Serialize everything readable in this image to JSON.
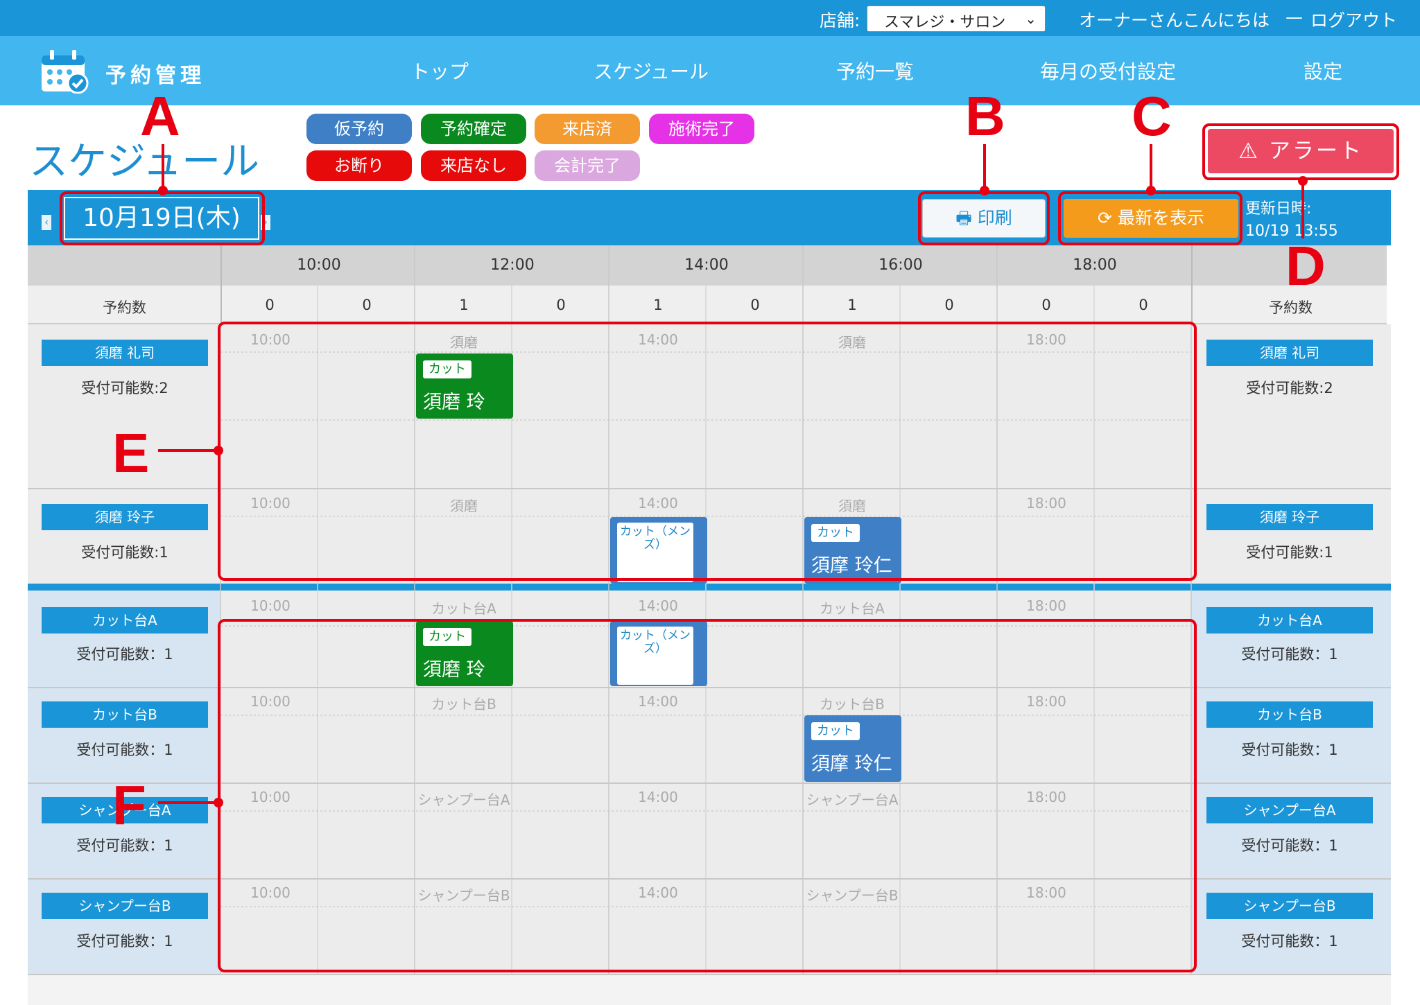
{
  "topbar": {
    "store_label": "店舗:",
    "store_value": "スマレジ・サロン",
    "greeting": "オーナーさんこんにちは",
    "separator": "—",
    "logout": "ログアウト"
  },
  "nav": {
    "app_title": "予約管理",
    "items": [
      "トップ",
      "スケジュール",
      "予約一覧",
      "毎月の受付設定",
      "設定"
    ]
  },
  "page": {
    "title": "スケジュール"
  },
  "legend": [
    {
      "label": "仮予約",
      "color": "#3e7fc6"
    },
    {
      "label": "予約確定",
      "color": "#0a8a1e"
    },
    {
      "label": "来店済",
      "color": "#f39a30"
    },
    {
      "label": "施術完了",
      "color": "#e632e6"
    },
    {
      "label": "お断り",
      "color": "#e60a0a"
    },
    {
      "label": "来店なし",
      "color": "#e60a0a"
    },
    {
      "label": "会計完了",
      "color": "#dba7df"
    }
  ],
  "toolbar": {
    "date": "10月19日(木)",
    "print": "印刷",
    "refresh": "最新を表示",
    "updated_label": "更新日時:",
    "updated_value": "10/19 13:55",
    "alert": "アラート"
  },
  "schedule": {
    "time_headers": [
      "10:00",
      "12:00",
      "14:00",
      "16:00",
      "18:00"
    ],
    "count_label": "予約数",
    "counts": [
      "0",
      "0",
      "1",
      "0",
      "1",
      "0",
      "1",
      "0",
      "0",
      "0"
    ],
    "staff_rows": [
      {
        "name": "須磨 礼司",
        "capacity": "受付可能数:2",
        "band": [
          "10:00",
          "須磨",
          "14:00",
          "須磨",
          "18:00"
        ]
      },
      {
        "name": "須磨 玲子",
        "capacity": "受付可能数:1",
        "band": [
          "10:00",
          "須磨",
          "14:00",
          "須磨",
          "18:00"
        ]
      }
    ],
    "resource_rows": [
      {
        "name": "カット台A",
        "capacity": "受付可能数：1",
        "band": [
          "10:00",
          "カット台A",
          "14:00",
          "カット台A",
          "18:00"
        ]
      },
      {
        "name": "カット台B",
        "capacity": "受付可能数：1",
        "band": [
          "10:00",
          "カット台B",
          "14:00",
          "カット台B",
          "18:00"
        ]
      },
      {
        "name": "シャンプー台A",
        "capacity": "受付可能数：1",
        "band": [
          "10:00",
          "シャンプー台A",
          "14:00",
          "シャンプー台A",
          "18:00"
        ]
      },
      {
        "name": "シャンプー台B",
        "capacity": "受付可能数：1",
        "band": [
          "10:00",
          "シャンプー台B",
          "14:00",
          "シャンプー台B",
          "18:00"
        ]
      }
    ],
    "appointments": {
      "a1": {
        "tag": "カット",
        "customer": "須磨 玲"
      },
      "a2": {
        "menu": "カット（メンズ）"
      },
      "a3": {
        "tag": "カット",
        "customer": "須摩 玲仁"
      },
      "a4": {
        "tag": "カット",
        "customer": "須磨 玲"
      },
      "a5": {
        "menu": "カット（メンズ）"
      },
      "a6": {
        "tag": "カット",
        "customer": "須摩 玲仁"
      }
    }
  },
  "annotations": [
    "A",
    "B",
    "C",
    "D",
    "E",
    "F"
  ]
}
